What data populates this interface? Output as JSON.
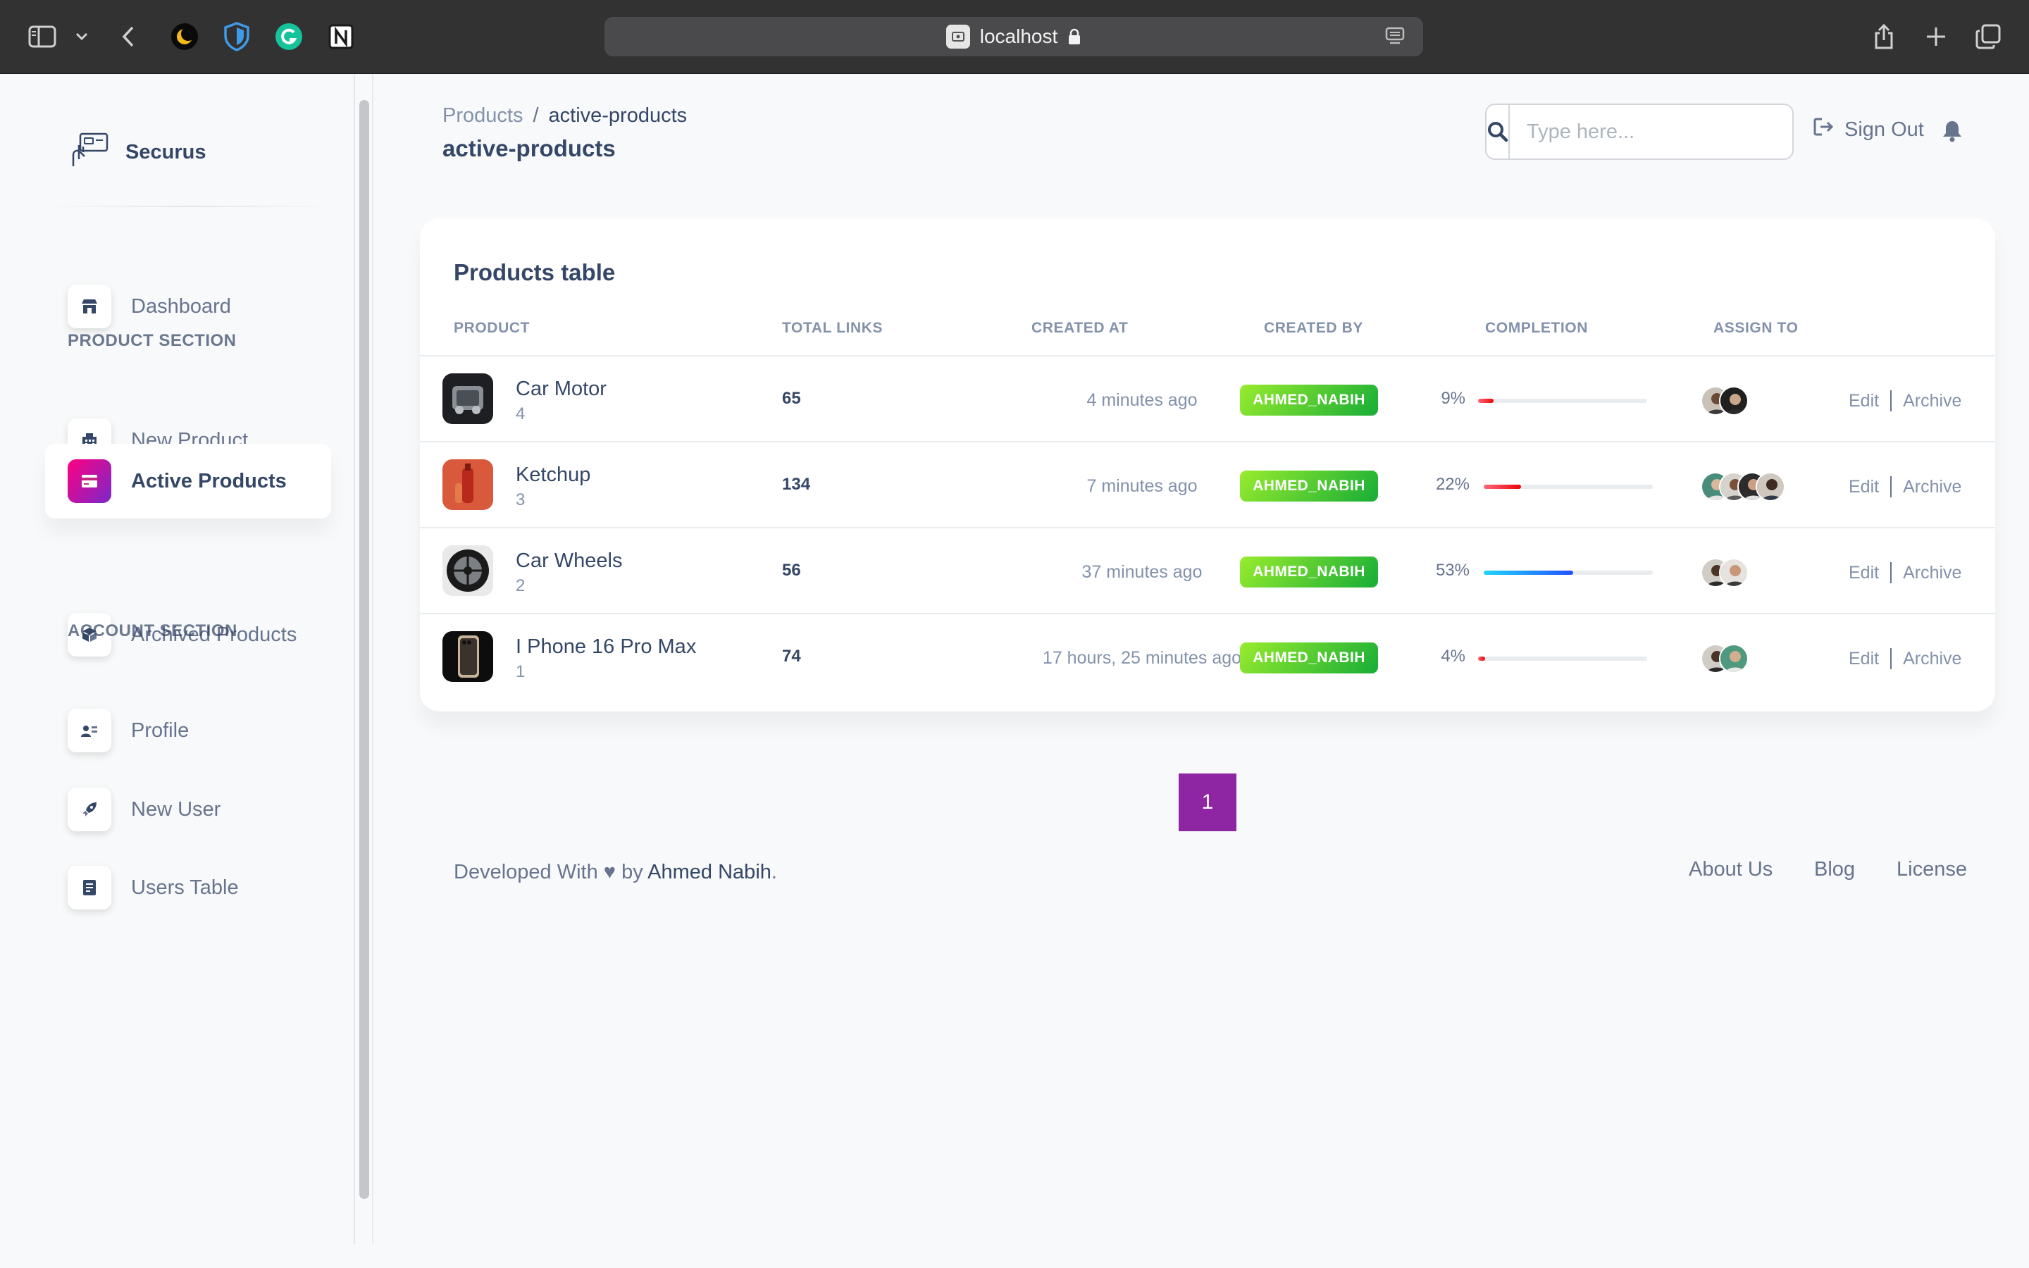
{
  "browser": {
    "url_host": "localhost",
    "icons": [
      "sidebar-toggle-icon",
      "chevron-down-icon",
      "back-icon",
      "moon-extension-icon",
      "shield-extension-icon",
      "grammarly-extension-icon",
      "notion-extension-icon",
      "share-icon",
      "new-tab-icon",
      "tabs-overview-icon"
    ]
  },
  "brand": {
    "name": "Securus"
  },
  "sidebar": {
    "items": [
      {
        "label": "Dashboard",
        "icon": "shop-icon",
        "active": false
      },
      {
        "label": "New Product",
        "icon": "office-icon",
        "active": false
      },
      {
        "label": "Active Products",
        "icon": "credit-card-icon",
        "active": true
      },
      {
        "label": "Archived Products",
        "icon": "box-icon",
        "active": false
      },
      {
        "label": "Profile",
        "icon": "user-card-icon",
        "active": false
      },
      {
        "label": "New User",
        "icon": "rocket-icon",
        "active": false
      },
      {
        "label": "Users Table",
        "icon": "document-icon",
        "active": false
      }
    ],
    "sections": {
      "product": "PRODUCT SECTION",
      "account": "ACCOUNT SECTION"
    }
  },
  "header": {
    "breadcrumb_root": "Products",
    "breadcrumb_sep": "/",
    "breadcrumb_current": "active-products",
    "title": "active-products",
    "search_placeholder": "Type here...",
    "sign_out": "Sign Out"
  },
  "table": {
    "title": "Products table",
    "columns": [
      "PRODUCT",
      "TOTAL LINKS",
      "CREATED AT",
      "CREATED BY",
      "COMPLETION",
      "ASSIGN TO"
    ],
    "rows": [
      {
        "name": "Car Motor",
        "count": "4",
        "links": "65",
        "created": "4 minutes ago",
        "by": "AHMED_NABIH",
        "completion": "9%",
        "progress": 0.09,
        "color": "#ea0606",
        "assignees": 2
      },
      {
        "name": "Ketchup",
        "count": "3",
        "links": "134",
        "created": "7 minutes ago",
        "by": "AHMED_NABIH",
        "completion": "22%",
        "progress": 0.22,
        "color": "#ea0606",
        "assignees": 4
      },
      {
        "name": "Car Wheels",
        "count": "2",
        "links": "56",
        "created": "37 minutes ago",
        "by": "AHMED_NABIH",
        "completion": "53%",
        "progress": 0.53,
        "color": "#2152ff",
        "assignees": 2
      },
      {
        "name": "I Phone 16 Pro Max",
        "count": "1",
        "links": "74",
        "created": "17 hours, 25 minutes ago",
        "by": "AHMED_NABIH",
        "completion": "4%",
        "progress": 0.04,
        "color": "#ea0606",
        "assignees": 2
      }
    ],
    "edit_label": "Edit",
    "archive_label": "Archive"
  },
  "pagination": {
    "current": "1"
  },
  "footer": {
    "prefix": "Developed With",
    "by": "by",
    "author": "Ahmed Nabih",
    "period": ".",
    "links": [
      "About Us",
      "Blog",
      "License"
    ]
  },
  "colors": {
    "accent_start": "#7928ca",
    "accent_end": "#ff0080",
    "badge": "#17ad37",
    "pager": "#8e26a4"
  }
}
